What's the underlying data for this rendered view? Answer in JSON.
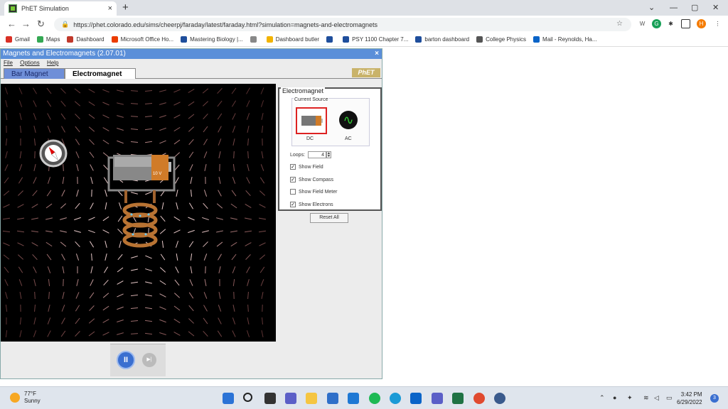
{
  "browser": {
    "tab_title": "PhET Simulation",
    "tab_close": "×",
    "new_tab": "+",
    "url": "https://phet.colorado.edu/sims/cheerpj/faraday/latest/faraday.html?simulation=magnets-and-electromagnets",
    "profile_initial": "H",
    "window_controls": {
      "collapse": "⌄",
      "minimize": "—",
      "maximize": "▢",
      "close": "✕"
    }
  },
  "bookmarks": [
    {
      "label": "Gmail",
      "icon": "gmail-icon",
      "color": "#d93025"
    },
    {
      "label": "Maps",
      "icon": "maps-icon",
      "color": "#34a853"
    },
    {
      "label": "Dashboard",
      "icon": "dashboard-icon",
      "color": "#c0392b"
    },
    {
      "label": "Microsoft Office Ho...",
      "icon": "office-icon",
      "color": "#eb3c00"
    },
    {
      "label": "Mastering Biology |...",
      "icon": "mastering-icon",
      "color": "#1f4e9c"
    },
    {
      "label": "",
      "icon": "globe-icon",
      "color": "#888888"
    },
    {
      "label": "Dashboard butler",
      "icon": "windows-icon",
      "color": "#f2b300"
    },
    {
      "label": "",
      "icon": "search-q-icon",
      "color": "#1f4e9c"
    },
    {
      "label": "PSY 1100 Chapter 7...",
      "icon": "quizlet-icon",
      "color": "#1f4e9c"
    },
    {
      "label": "barton dashboard",
      "icon": "bbbbb-icon",
      "color": "#1f4e9c"
    },
    {
      "label": "College Physics",
      "icon": "physics-icon",
      "color": "#555555"
    },
    {
      "label": "Mail - Reynolds, Ha...",
      "icon": "outlook-icon",
      "color": "#0a64c8"
    }
  ],
  "applet": {
    "title": "Magnets and Electromagnets (2.07.01)",
    "close": "×",
    "menu": [
      "File",
      "Options",
      "Help"
    ],
    "tabs": [
      "Bar Magnet",
      "Electromagnet"
    ],
    "logo": "PhET"
  },
  "battery": {
    "voltage_label": "10 V"
  },
  "controls": {
    "group_title": "Electromagnet",
    "current_source_title": "Current Source",
    "dc_label": "DC",
    "ac_label": "AC",
    "ac_symbol": "∿",
    "loops_label": "Loops:",
    "loops_value": "4",
    "show_field": "Show Field",
    "show_compass": "Show Compass",
    "show_field_meter": "Show Field Meter",
    "show_electrons": "Show Electrons",
    "checkbox_states": {
      "show_field": true,
      "show_compass": true,
      "show_field_meter": false,
      "show_electrons": true
    },
    "reset": "Reset All"
  },
  "clock": {
    "pause_symbol": "II",
    "step_symbol": "▶|"
  },
  "taskbar": {
    "temperature": "77°F",
    "condition": "Sunny",
    "time": "3:42 PM",
    "date": "6/29/2022",
    "notification_count": "3"
  }
}
